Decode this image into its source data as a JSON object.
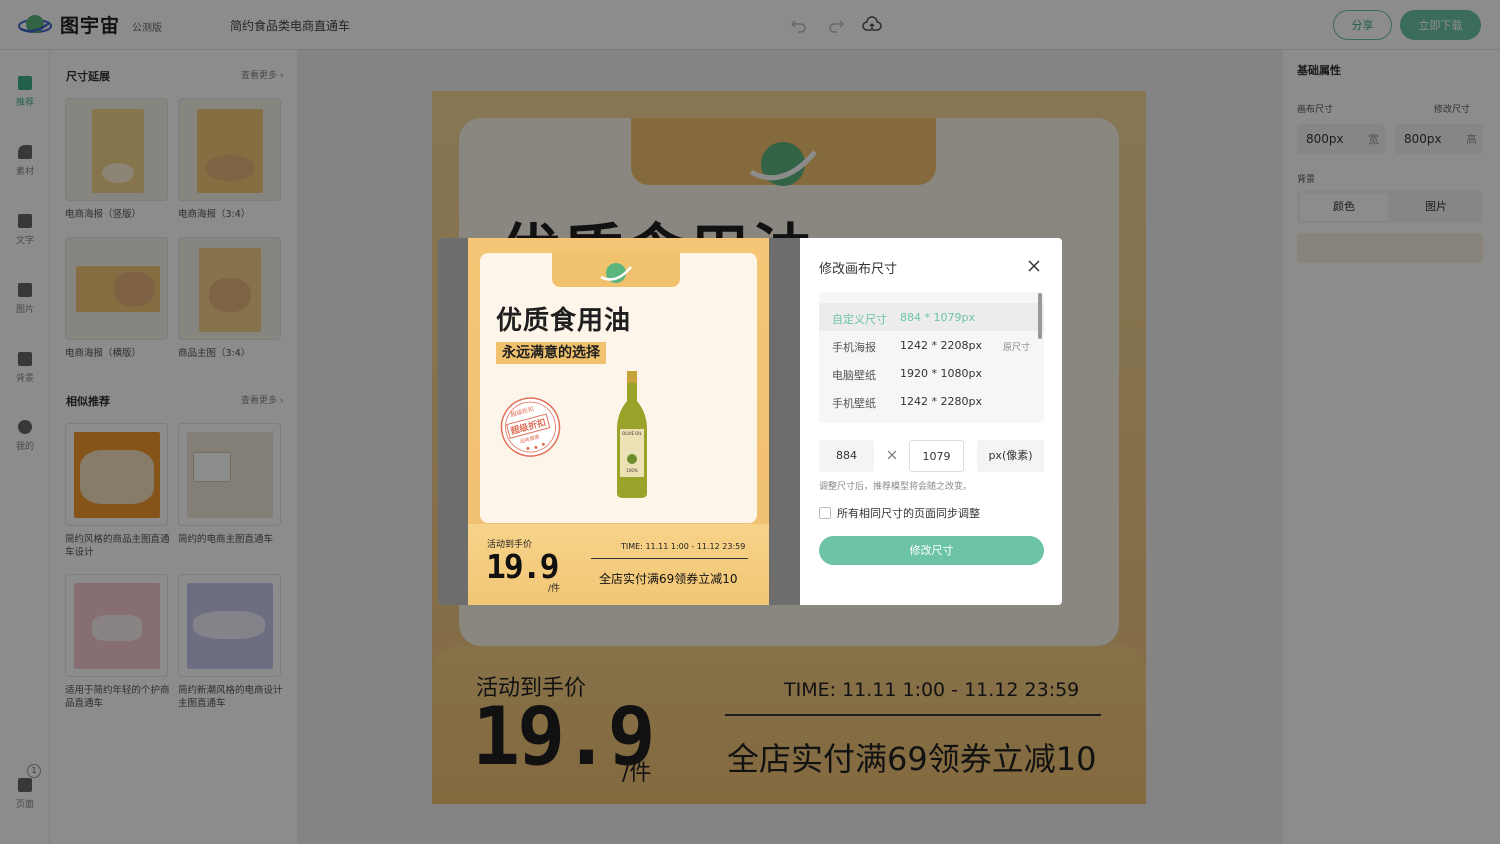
{
  "header": {
    "brand": "图宇宙",
    "beta": "公测版",
    "doc_title": "简约食品类电商直通车",
    "share_label": "分享",
    "download_label": "立即下载"
  },
  "leftnav": [
    {
      "label": "推荐",
      "icon": "recommend-icon"
    },
    {
      "label": "素材",
      "icon": "shapes-icon"
    },
    {
      "label": "文字",
      "icon": "text-icon"
    },
    {
      "label": "图片",
      "icon": "image-icon"
    },
    {
      "label": "背景",
      "icon": "background-icon"
    },
    {
      "label": "我的",
      "icon": "user-icon"
    }
  ],
  "pages": {
    "label": "页面",
    "count": "1"
  },
  "sidepanel": {
    "section1": {
      "title": "尺寸延展",
      "more": "查看更多"
    },
    "section2": {
      "title": "相似推荐",
      "more": "查看更多"
    },
    "templates1": [
      {
        "label": "电商海报（竖版）"
      },
      {
        "label": "电商海报（3:4）"
      },
      {
        "label": "电商海报（横版）"
      },
      {
        "label": "商品主图（3:4）"
      }
    ],
    "templates2": [
      {
        "label": "简约风格的商品主图直通车设计"
      },
      {
        "label": "简约的电商主图直通车"
      },
      {
        "label": "适用于简约年轻的个护商品直通车"
      },
      {
        "label": "简约新潮风格的电商设计主图直通车"
      }
    ]
  },
  "rightpanel": {
    "title": "基础属性",
    "canvas_size_label": "画布尺寸",
    "edit_size_label": "修改尺寸",
    "width_value": "800px",
    "width_unit": "宽",
    "height_value": "800px",
    "height_unit": "高",
    "background_label": "背景",
    "tab_color": "颜色",
    "tab_image": "图片"
  },
  "poster": {
    "headline": "优质食用油",
    "price_label": "活动到手价",
    "price": "19.9",
    "unit": "/件",
    "time": "TIME: 11.11 1:00 - 11.12 23:59",
    "promo": "全店实付满69领券立减10"
  },
  "preview": {
    "headline": "优质食用油",
    "subheadline": "永远满意的选择",
    "stamp_top": "超级折扣",
    "stamp_main": "超级折扣",
    "stamp_bottom": "品味健康",
    "bottle_label": "OLIVE OIL",
    "bottle_badge": "100%",
    "price_label": "活动到手价",
    "price": "19.9",
    "unit": "/件",
    "time": "TIME: 11.11 1:00 - 11.12 23:59",
    "promo": "全店实付满69领券立减10"
  },
  "dialog": {
    "title": "修改画布尺寸",
    "sizes": [
      {
        "name": "自定义尺寸",
        "dim": "884 * 1079px",
        "note": ""
      },
      {
        "name": "手机海报",
        "dim": "1242 * 2208px",
        "note": "原尺寸"
      },
      {
        "name": "电脑壁纸",
        "dim": "1920 * 1080px",
        "note": ""
      },
      {
        "name": "手机壁纸",
        "dim": "1242 * 2280px",
        "note": ""
      }
    ],
    "width": "884",
    "height": "1079",
    "unit": "px(像素)",
    "hint": "调整尺寸后，推荐模型将会随之改变。",
    "sync_label": "所有相同尺寸的页面同步调整",
    "apply_label": "修改尺寸"
  },
  "colors": {
    "accent": "#6cc4a4",
    "poster_bg": "#f0c26e"
  }
}
